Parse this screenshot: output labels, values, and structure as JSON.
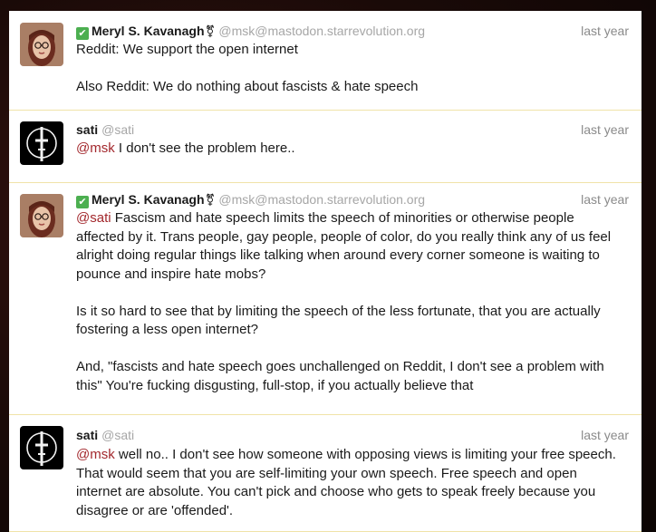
{
  "statuses": [
    {
      "verified_mark": "✔",
      "display_name": "Meryl S. Kavanagh",
      "name_glyph": "⚧",
      "handle": "@msk@mastodon.starrevolution.org",
      "timestamp": "last year",
      "avatar": "woman-portrait-avatar",
      "paragraphs": [
        {
          "text": "Reddit: We support the open internet"
        },
        {
          "text": "Also Reddit: We do nothing about fascists & hate speech"
        }
      ]
    },
    {
      "display_name": "sati",
      "handle": "@sati",
      "timestamp": "last year",
      "avatar": "cross-symbol-avatar",
      "paragraphs": [
        {
          "mention": "@msk",
          "text": " I don't see the problem here.."
        }
      ]
    },
    {
      "verified_mark": "✔",
      "display_name": "Meryl S. Kavanagh",
      "name_glyph": "⚧",
      "handle": "@msk@mastodon.starrevolution.org",
      "timestamp": "last year",
      "avatar": "woman-portrait-avatar",
      "paragraphs": [
        {
          "mention": "@sati",
          "text": " Fascism and hate speech limits the speech of minorities or otherwise people affected by it. Trans people, gay people, people of color, do you really think any of us feel alright doing regular things like talking when around every corner someone is waiting to pounce and inspire hate mobs?"
        },
        {
          "text": "Is it so hard to see that by limiting the speech of the less fortunate, that you are actually fostering a less open internet?"
        },
        {
          "text": "And, \"fascists and hate speech goes unchallenged on Reddit, I don't see a problem with this\" You're fucking disgusting, full-stop, if you actually believe that"
        }
      ]
    },
    {
      "display_name": "sati",
      "handle": "@sati",
      "timestamp": "last year",
      "avatar": "cross-symbol-avatar",
      "paragraphs": [
        {
          "mention": "@msk",
          "text": " well no.. I don't see how someone with opposing views is limiting your free speech. That would seem that you are self-limiting your own speech. Free speech and open internet are absolute. You can't pick and choose who gets to speak freely because you disagree or are 'offended'."
        }
      ]
    }
  ],
  "colors": {
    "mention": "#a3282d",
    "divider": "#f0e3a8",
    "verified": "#4caf50",
    "timestamp": "#8a8a8a",
    "handle": "#a6a6a6"
  }
}
